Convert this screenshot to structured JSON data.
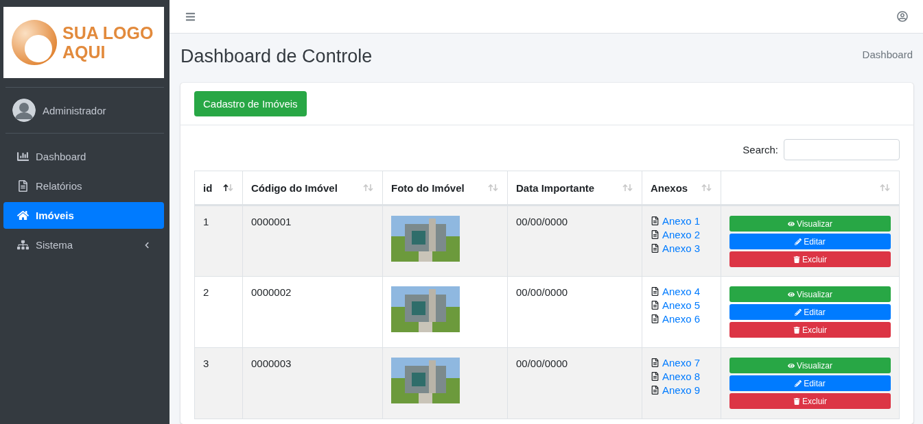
{
  "sidebar": {
    "logo": {
      "line1": "SUA LOGO",
      "line2": "AQUI"
    },
    "user": "Administrador",
    "items": [
      {
        "label": "Dashboard",
        "selected": false,
        "submenu": false
      },
      {
        "label": "Relatórios",
        "selected": false,
        "submenu": false
      },
      {
        "label": "Imóveis",
        "selected": true,
        "submenu": false
      },
      {
        "label": "Sistema",
        "selected": false,
        "submenu": true
      }
    ]
  },
  "page": {
    "title": "Dashboard de Controle",
    "breadcrumb": "Dashboard"
  },
  "card": {
    "new_button": "Cadastro de Imóveis",
    "search_label": "Search:",
    "columns": [
      {
        "label": "id",
        "sorted": true
      },
      {
        "label": "Código do Imóvel",
        "sorted": false
      },
      {
        "label": "Foto do Imóvel",
        "sorted": false
      },
      {
        "label": "Data Importante",
        "sorted": false
      },
      {
        "label": "Anexos",
        "sorted": false
      },
      {
        "sorted": false
      }
    ],
    "rows": [
      {
        "id": "1",
        "code": "0000001",
        "date": "00/00/0000",
        "attachments": [
          "Anexo 1",
          "Anexo 2",
          "Anexo 3"
        ],
        "actions": [
          {
            "kind": "view",
            "label": "Visualizar"
          },
          {
            "kind": "edit",
            "label": "Editar"
          },
          {
            "kind": "delete",
            "label": "Excluir"
          }
        ]
      },
      {
        "id": "2",
        "code": "0000002",
        "date": "00/00/0000",
        "attachments": [
          "Anexo 4",
          "Anexo 5",
          "Anexo 6"
        ],
        "actions": [
          {
            "kind": "view",
            "label": "Visualizar"
          },
          {
            "kind": "edit",
            "label": "Editar"
          },
          {
            "kind": "delete",
            "label": "Excluir"
          }
        ]
      },
      {
        "id": "3",
        "code": "0000003",
        "date": "00/00/0000",
        "attachments": [
          "Anexo 7",
          "Anexo 8",
          "Anexo 9"
        ],
        "actions": [
          {
            "kind": "view",
            "label": "Visualizar"
          },
          {
            "kind": "edit",
            "label": "Editar"
          },
          {
            "kind": "delete",
            "label": "Excluir"
          }
        ]
      }
    ]
  }
}
